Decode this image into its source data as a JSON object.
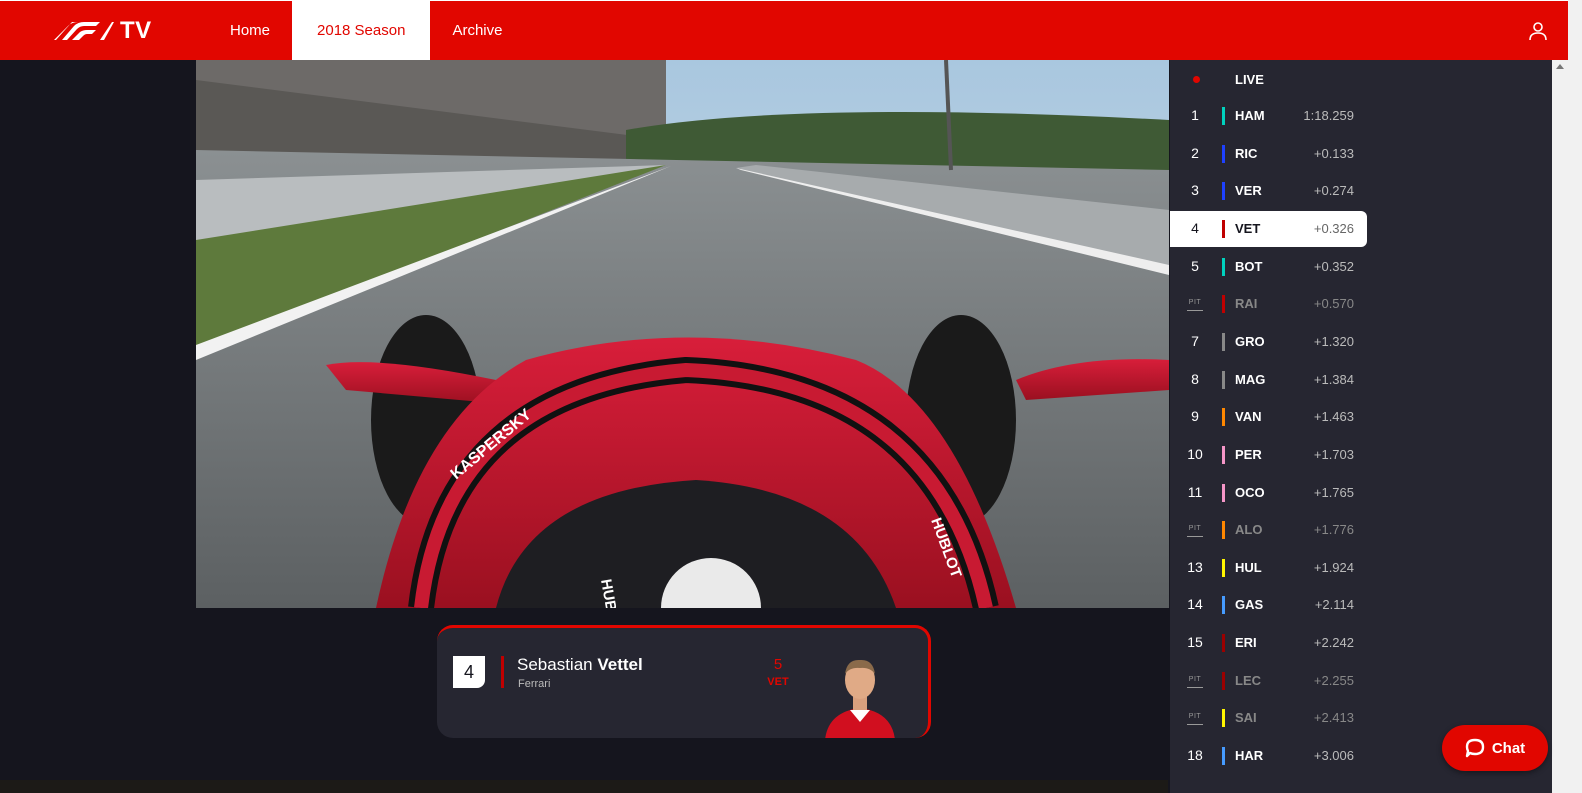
{
  "header": {
    "logo_text": "TV",
    "nav": [
      {
        "label": "Home"
      },
      {
        "label": "2018 Season"
      },
      {
        "label": "Archive"
      }
    ],
    "active_tab": "2018 Season"
  },
  "driver_card": {
    "position": "4",
    "first_name": "Sebastian",
    "last_name": "Vettel",
    "team": "Ferrari",
    "number": "5",
    "code": "VET",
    "team_color": "#c00000"
  },
  "tower": {
    "live_label": "LIVE",
    "pit_label": "PIT",
    "rows": [
      {
        "pos": "1",
        "code": "HAM",
        "gap": "1:18.259",
        "color": "#00d2be"
      },
      {
        "pos": "2",
        "code": "RIC",
        "gap": "+0.133",
        "color": "#1e41ff"
      },
      {
        "pos": "3",
        "code": "VER",
        "gap": "+0.274",
        "color": "#1e41ff"
      },
      {
        "pos": "4",
        "code": "VET",
        "gap": "+0.326",
        "color": "#c00000"
      },
      {
        "pos": "5",
        "code": "BOT",
        "gap": "+0.352",
        "color": "#00d2be"
      },
      {
        "pos": "",
        "code": "RAI",
        "gap": "+0.570",
        "color": "#c00000"
      },
      {
        "pos": "7",
        "code": "GRO",
        "gap": "+1.320",
        "color": "#888888"
      },
      {
        "pos": "8",
        "code": "MAG",
        "gap": "+1.384",
        "color": "#888888"
      },
      {
        "pos": "9",
        "code": "VAN",
        "gap": "+1.463",
        "color": "#ff8700"
      },
      {
        "pos": "10",
        "code": "PER",
        "gap": "+1.703",
        "color": "#f596c8"
      },
      {
        "pos": "11",
        "code": "OCO",
        "gap": "+1.765",
        "color": "#f596c8"
      },
      {
        "pos": "",
        "code": "ALO",
        "gap": "+1.776",
        "color": "#ff8700"
      },
      {
        "pos": "13",
        "code": "HUL",
        "gap": "+1.924",
        "color": "#fff500"
      },
      {
        "pos": "14",
        "code": "GAS",
        "gap": "+2.114",
        "color": "#469bff"
      },
      {
        "pos": "15",
        "code": "ERI",
        "gap": "+2.242",
        "color": "#9b0000"
      },
      {
        "pos": "",
        "code": "LEC",
        "gap": "+2.255",
        "color": "#9b0000"
      },
      {
        "pos": "",
        "code": "SAI",
        "gap": "+2.413",
        "color": "#fff500"
      },
      {
        "pos": "18",
        "code": "HAR",
        "gap": "+3.006",
        "color": "#469bff"
      }
    ],
    "selected_code": "VET",
    "pit_codes": [
      "RAI",
      "ALO",
      "LEC",
      "SAI"
    ]
  },
  "chat": {
    "label": "Chat"
  },
  "colors": {
    "brand": "#e10600",
    "background": "#15151e",
    "panel": "#262631"
  }
}
